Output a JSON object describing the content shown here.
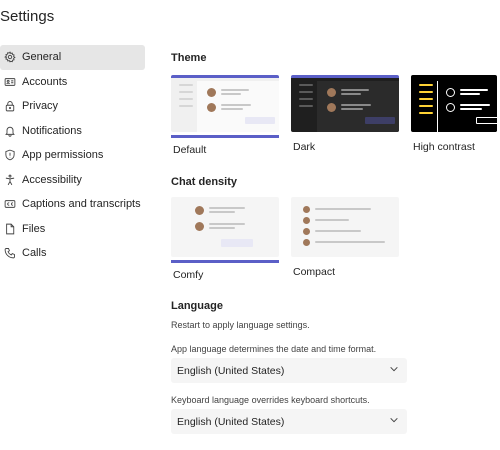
{
  "window": {
    "title": "Settings"
  },
  "sidebar": {
    "items": [
      {
        "label": "General",
        "icon": "gear-icon",
        "active": true
      },
      {
        "label": "Accounts",
        "icon": "id-card-icon",
        "active": false
      },
      {
        "label": "Privacy",
        "icon": "lock-icon",
        "active": false
      },
      {
        "label": "Notifications",
        "icon": "bell-icon",
        "active": false
      },
      {
        "label": "App permissions",
        "icon": "shield-icon",
        "active": false
      },
      {
        "label": "Accessibility",
        "icon": "accessibility-icon",
        "active": false
      },
      {
        "label": "Captions and transcripts",
        "icon": "closed-captions-icon",
        "active": false
      },
      {
        "label": "Files",
        "icon": "file-icon",
        "active": false
      },
      {
        "label": "Calls",
        "icon": "phone-icon",
        "active": false
      }
    ]
  },
  "theme": {
    "title": "Theme",
    "options": [
      {
        "label": "Default",
        "selected": true
      },
      {
        "label": "Dark",
        "selected": false
      },
      {
        "label": "High contrast",
        "selected": false
      }
    ]
  },
  "density": {
    "title": "Chat density",
    "options": [
      {
        "label": "Comfy",
        "selected": true
      },
      {
        "label": "Compact",
        "selected": false
      }
    ]
  },
  "language": {
    "title": "Language",
    "restart_note": "Restart to apply language settings.",
    "app_hint": "App language determines the date and time format.",
    "app_value": "English (United States)",
    "keyboard_hint": "Keyboard language overrides keyboard shortcuts.",
    "keyboard_value": "English (United States)"
  },
  "colors": {
    "accent": "#5b5fc7",
    "active_nav_bg": "#e6e6e6",
    "select_bg": "#f5f5f5",
    "hc_yellow": "#ffd335"
  }
}
